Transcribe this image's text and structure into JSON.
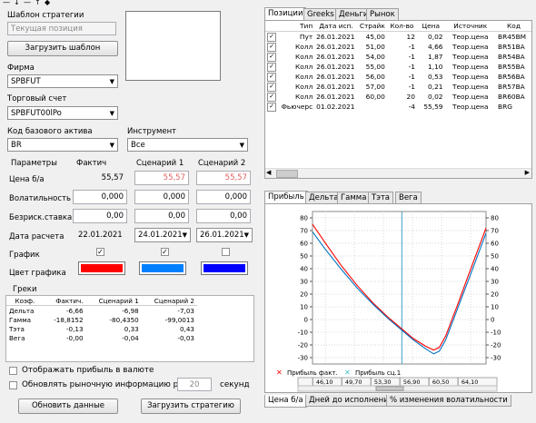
{
  "toolbar": {
    "icons": [
      "minus-icon",
      "arrow-down-icon",
      "line-icon",
      "arrow-up-icon",
      "diamond-icon"
    ]
  },
  "strategy": {
    "title": "Шаблон стратегии",
    "current_placeholder": "Текущая позиция",
    "load_template": "Загрузить шаблон"
  },
  "firm": {
    "label": "Фирма",
    "value": "SPBFUT"
  },
  "account": {
    "label": "Торговый счет",
    "value": "SPBFUT00lPo"
  },
  "base_asset": {
    "label": "Код базового актива",
    "value": "BR"
  },
  "instrument": {
    "label": "Инструмент",
    "value": "Все"
  },
  "params": {
    "header": {
      "name": "Параметры",
      "fact": "Фактич",
      "s1": "Сценарий 1",
      "s2": "Сценарий 2"
    },
    "rows": {
      "price": {
        "label": "Цена б/а",
        "fact": "55,57",
        "s1": "55,57",
        "s2": "55,57"
      },
      "vol": {
        "label": "Волатильность",
        "fact": "0,000",
        "s1": "0,000",
        "s2": "0,000"
      },
      "rate": {
        "label": "Безриск.ставка",
        "fact": "0,00",
        "s1": "0,00",
        "s2": "0,00"
      },
      "date": {
        "label": "Дата расчета",
        "fact": "22.01.2021",
        "s1": "24.01.2021",
        "s2": "26.01.2021"
      },
      "chart": {
        "label": "График",
        "fact": true,
        "s1": true,
        "s2": false
      },
      "color": {
        "label": "Цвет графика",
        "fact": "#ff0000",
        "s1": "#0080ff",
        "s2": "#0000ff"
      }
    }
  },
  "greeks": {
    "title": "Греки",
    "headers": [
      "Коэф.",
      "Фактич.",
      "Сценарий 1",
      "Сценарий 2"
    ],
    "rows": [
      [
        "Дельта",
        "-6,66",
        "-6,98",
        "-7,03"
      ],
      [
        "Гамма",
        "-18,8152",
        "-80,4350",
        "-99,0013"
      ],
      [
        "Тэта",
        "-0,13",
        "0,33",
        "0,43"
      ],
      [
        "Вега",
        "-0,00",
        "-0,04",
        "-0,03"
      ]
    ]
  },
  "options": {
    "show_currency": "Отображать прибыль в валюте",
    "refresh_every": "Обновлять рыночную информацию раз в",
    "seconds_value": "20",
    "seconds": "секунд"
  },
  "buttons": {
    "refresh": "Обновить данные",
    "load_strategy": "Загрузить стратегию"
  },
  "top_tabs": [
    "Позиции",
    "Greeks",
    "Деньги",
    "Рынок"
  ],
  "positions": {
    "headers": [
      "",
      "Тип",
      "Дата исп.",
      "Страйк",
      "Кол-во",
      "Цена",
      "Источник",
      "Код"
    ],
    "rows": [
      [
        true,
        "Пут",
        "26.01.2021",
        "45,00",
        "12",
        "0,02",
        "Теор.цена",
        "BR45BM"
      ],
      [
        true,
        "Колл",
        "26.01.2021",
        "51,00",
        "-1",
        "4,66",
        "Теор.цена",
        "BR51BA"
      ],
      [
        true,
        "Колл",
        "26.01.2021",
        "54,00",
        "-1",
        "1,87",
        "Теор.цена",
        "BR54BA"
      ],
      [
        true,
        "Колл",
        "26.01.2021",
        "55,00",
        "-1",
        "1,10",
        "Теор.цена",
        "BR55BA"
      ],
      [
        true,
        "Колл",
        "26.01.2021",
        "56,00",
        "-1",
        "0,53",
        "Теор.цена",
        "BR56BA"
      ],
      [
        true,
        "Колл",
        "26.01.2021",
        "57,00",
        "-1",
        "0,21",
        "Теор.цена",
        "BR57BA"
      ],
      [
        true,
        "Колл",
        "26.01.2021",
        "60,00",
        "20",
        "0,02",
        "Теор.цена",
        "BR60BA"
      ],
      [
        true,
        "Фьючерс",
        "01.02.2021",
        "",
        "-4",
        "55,59",
        "Теор.цена",
        "BRG"
      ]
    ]
  },
  "chart_tabs": [
    "Прибыль",
    "Дельта",
    "Гамма",
    "Тэта",
    "Вега"
  ],
  "bottom_tabs": [
    "Цена б/а",
    "Дней до исполнения",
    "% изменения волатильности"
  ],
  "chart_data": {
    "type": "line",
    "ylim": [
      -35,
      85
    ],
    "yticks": [
      -30,
      -20,
      -10,
      0,
      10,
      20,
      30,
      40,
      50,
      60,
      70,
      80
    ],
    "xlim": [
      44.5,
      66
    ],
    "xticks": [
      "46,10",
      "49,70",
      "53,30",
      "56,90",
      "60,50",
      "64,10"
    ],
    "xtick_values": [
      46.1,
      49.7,
      53.3,
      56.9,
      60.5,
      64.1
    ],
    "current_price": 55.57,
    "series": [
      {
        "name": "Прибыль факт.",
        "color": "#ff0000",
        "x": [
          44.5,
          46,
          48,
          50,
          52,
          54,
          55.5,
          57,
          58.5,
          59.5,
          60.2,
          61,
          62.5,
          64,
          66
        ],
        "y": [
          75,
          61,
          43,
          27,
          13,
          1,
          -7,
          -15,
          -21,
          -24,
          -22,
          -13,
          12,
          38,
          72
        ]
      },
      {
        "name": "Прибыль сц.1",
        "color": "#0070c0",
        "x": [
          44.5,
          46,
          48,
          50,
          52,
          54,
          55.5,
          57,
          58.5,
          59.5,
          60.2,
          61,
          62.5,
          64,
          66
        ],
        "y": [
          69,
          56,
          40,
          25,
          12,
          0,
          -8,
          -16,
          -23,
          -27,
          -25,
          -16,
          9,
          34,
          68
        ]
      }
    ]
  }
}
